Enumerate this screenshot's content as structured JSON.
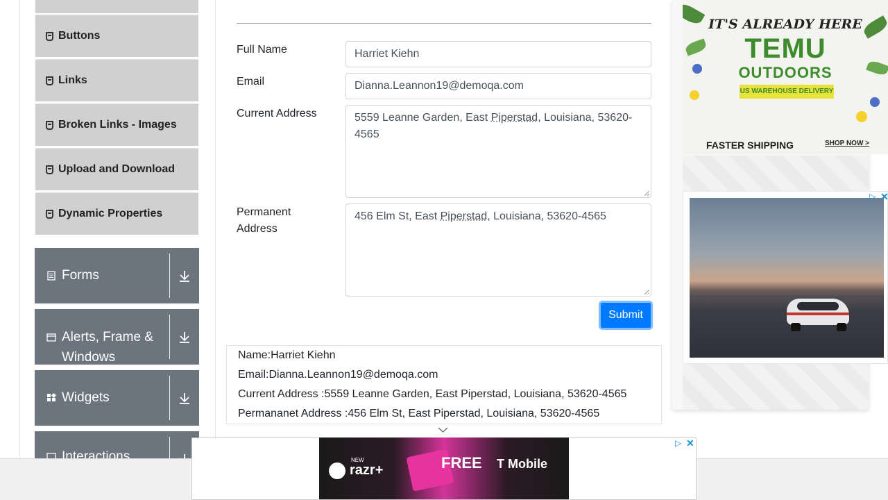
{
  "sidebar": {
    "elements_items": [
      {
        "label": "Buttons"
      },
      {
        "label": "Links"
      },
      {
        "label": "Broken Links - Images"
      },
      {
        "label": "Upload and Download"
      },
      {
        "label": "Dynamic Properties"
      }
    ],
    "groups": [
      {
        "label": "Forms"
      },
      {
        "label": "Alerts, Frame & Windows"
      },
      {
        "label": "Widgets"
      },
      {
        "label": "Interactions"
      }
    ]
  },
  "form": {
    "full_name_label": "Full Name",
    "full_name_value": "Harriet Kiehn",
    "email_label": "Email",
    "email_value": "Dianna.Leannon19@demoqa.com",
    "current_address_label": "Current Address",
    "current_address_value": {
      "before": "5559 Leanne Garden, East ",
      "marked": "Piperstad",
      "after": ", Louisiana, 53620-4565"
    },
    "permanent_address_label": "Permanent Address",
    "permanent_address_value": {
      "before": "456 Elm St, East ",
      "marked": "Piperstad",
      "after": ", Louisiana, 53620-4565"
    },
    "submit_label": "Submit"
  },
  "output": {
    "name": "Name:Harriet Kiehn",
    "email": "Email:Dianna.Leannon19@demoqa.com",
    "current_address": "Current Address :5559 Leanne Garden, East Piperstad, Louisiana, 53620-4565",
    "permanent_address": "Permananet Address :456 Elm St, East Piperstad, Louisiana, 53620-4565"
  },
  "ads": {
    "temu": {
      "headline": "IT'S ALREADY HERE",
      "brand": "TEMU",
      "sub": "OUTDOORS",
      "badge": "US WAREHOUSE DELIVERY",
      "shipping": "FASTER SHIPPING",
      "cta": "SHOP NOW >"
    },
    "moto": {
      "new": "NEW",
      "brand": "razr+",
      "offer": "FREE",
      "carrier": "T Mobile"
    }
  }
}
